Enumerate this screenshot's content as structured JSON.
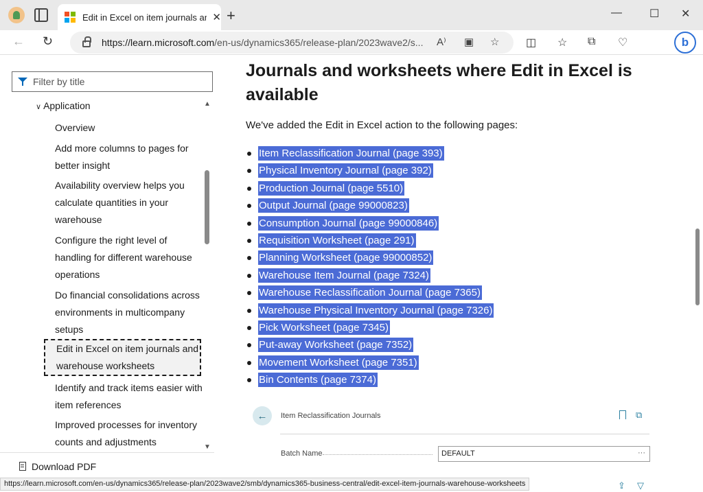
{
  "browser": {
    "tab_title": "Edit in Excel on item journals and warehouse worksheets",
    "tab_close": "✕",
    "new_tab": "+",
    "window_controls": {
      "minimize": "—",
      "maximize": "☐",
      "close": "✕"
    },
    "url_domain": "https://learn.microsoft.com",
    "url_path": "/en-us/dynamics365/release-plan/2023wave2/s...",
    "status_url": "https://learn.microsoft.com/en-us/dynamics365/release-plan/2023wave2/smb/dynamics365-business-central/edit-excel-item-journals-warehouse-worksheets",
    "icons": [
      "profile-icon",
      "tab-actions-icon",
      "microsoft-logo-icon",
      "back-icon",
      "refresh-icon",
      "lock-icon",
      "read-aloud-icon",
      "app-available-icon",
      "favorite-star-icon",
      "split-screen-icon",
      "favorites-icon",
      "collections-icon",
      "browser-essentials-icon",
      "bing-copilot-icon"
    ],
    "bing_label": "b",
    "colors": {
      "selection": "#4b6bd6",
      "link": "#0067b8"
    }
  },
  "sidebar": {
    "filter_placeholder": "Filter by title",
    "section": "Application",
    "items": [
      {
        "label": "Overview"
      },
      {
        "label": "Add more columns to pages for better insight"
      },
      {
        "label": "Availability overview helps you calculate quantities in your warehouse"
      },
      {
        "label": "Configure the right level of handling for different warehouse operations"
      },
      {
        "label": "Do financial consolidations across environments in multicompany setups"
      },
      {
        "label": "Edit in Excel on item journals and warehouse worksheets",
        "active": true
      },
      {
        "label": "Identify and track items easier with item references"
      },
      {
        "label": "Improved processes for inventory counts and adjustments"
      }
    ],
    "download_label": "Download PDF"
  },
  "article": {
    "heading": "Journals and worksheets where Edit in Excel is available",
    "intro": "We've added the Edit in Excel action to the following pages:",
    "pages": [
      "Item Reclassification Journal (page 393)",
      "Physical Inventory Journal (page 392)",
      "Production Journal (page 5510)",
      "Output Journal (page 99000823)",
      "Consumption Journal (page 99000846)",
      "Requisition Worksheet (page 291)",
      "Planning Worksheet (page 99000852)",
      "Warehouse Item Journal (page 7324)",
      "Warehouse Reclassification Journal (page 7365)",
      "Warehouse Physical Inventory Journal (page 7326)",
      "Pick Worksheet (page 7345)",
      "Put-away Worksheet (page 7352)",
      "Movement Worksheet (page 7351)",
      "Bin Contents (page 7374)"
    ]
  },
  "embedded": {
    "page_title": "Item Reclassification Journals",
    "batch_label": "Batch Name",
    "batch_value": "DEFAULT",
    "more": "···"
  }
}
